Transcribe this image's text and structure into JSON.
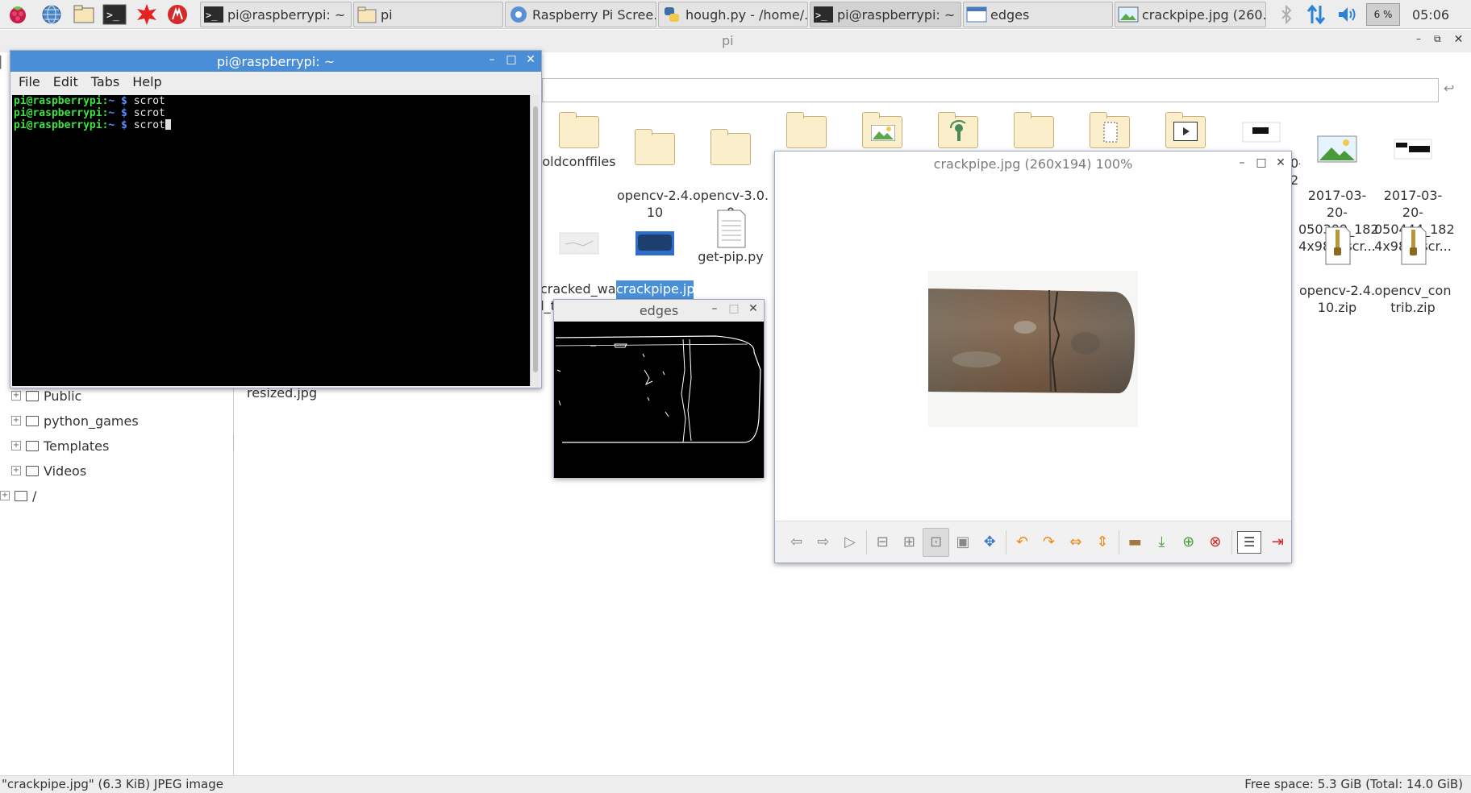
{
  "taskbar": {
    "launchers": [
      "raspberry-menu-icon",
      "web-browser-icon",
      "file-manager-icon",
      "terminal-icon",
      "math-kernel-icon",
      "wolfram-icon"
    ],
    "tasks": [
      {
        "label": "pi@raspberrypi: ~",
        "icon": "terminal-icon"
      },
      {
        "label": "pi",
        "icon": "folder-icon"
      },
      {
        "label": "Raspberry Pi Scree...",
        "icon": "chromium-icon"
      },
      {
        "label": "hough.py - /home/...",
        "icon": "python-icon"
      },
      {
        "label": "pi@raspberrypi: ~",
        "icon": "terminal-icon"
      },
      {
        "label": "edges",
        "icon": "window-icon"
      },
      {
        "label": "crackpipe.jpg (260...",
        "icon": "image-viewer-icon"
      }
    ],
    "cpu": "6 %",
    "clock": "05:06"
  },
  "file_manager": {
    "title": "pi",
    "status_left": "\"crackpipe.jpg\" (6.3 KiB) JPEG image",
    "status_right": "Free space: 5.3 GiB (Total: 14.0 GiB)",
    "tree": [
      {
        "label": "Public"
      },
      {
        "label": "python_games"
      },
      {
        "label": "Templates"
      },
      {
        "label": "Videos"
      },
      {
        "label": "/"
      }
    ],
    "files_row1": [
      {
        "name": "oldconffiles",
        "type": "folder"
      },
      {
        "name": "opencv-2.4.\n10",
        "type": "folder"
      },
      {
        "name": "opencv-3.0.\n0",
        "type": "folder"
      },
      {
        "name": "",
        "type": "folder"
      },
      {
        "name": "",
        "type": "image-folder"
      },
      {
        "name": "",
        "type": "broadcast-folder"
      },
      {
        "name": "",
        "type": "folder"
      },
      {
        "name": "",
        "type": "template-folder"
      },
      {
        "name": "",
        "type": "video-folder"
      },
      {
        "name": "",
        "type": "screenshot"
      },
      {
        "name": "2017-03-20-\n050309_182\n4x984_scr...",
        "type": "image"
      },
      {
        "name": "2017-03-20-\n050444_182\n4x984_scr...",
        "type": "image"
      }
    ],
    "files_row2": [
      {
        "name": "cracked_wal\nl_texture.pn\ng",
        "type": "image"
      },
      {
        "name": "crackpipe.jp\ng",
        "type": "image",
        "selected": true
      },
      {
        "name": "get-pip.py",
        "type": "text"
      },
      {
        "name": "opencv-2.4.\n10.zip",
        "type": "zip"
      },
      {
        "name": "opencv_con\ntrib.zip",
        "type": "zip"
      }
    ],
    "partial_labels": {
      "resized": "resized.jpg",
      "cut_2017": "0-\n2"
    }
  },
  "terminal": {
    "title": "pi@raspberrypi: ~",
    "menu": [
      "File",
      "Edit",
      "Tabs",
      "Help"
    ],
    "lines": [
      {
        "user": "pi@raspberrypi",
        "path": "~",
        "cmd": "scrot"
      },
      {
        "user": "pi@raspberrypi",
        "path": "~",
        "cmd": "scrot"
      },
      {
        "user": "pi@raspberrypi",
        "path": "~",
        "cmd": "scrot"
      }
    ]
  },
  "edges_window": {
    "title": "edges"
  },
  "viewer": {
    "title": "crackpipe.jpg (260x194) 100%",
    "toolbar": [
      "prev-icon",
      "next-icon",
      "slideshow-icon",
      "zoom-out-icon",
      "zoom-in-icon",
      "fit-icon",
      "original-size-icon",
      "fullscreen-icon",
      "rotate-left-icon",
      "rotate-right-icon",
      "flip-horizontal-icon",
      "flip-vertical-icon",
      "open-icon",
      "save-icon",
      "save-as-icon",
      "delete-icon",
      "preferences-icon",
      "quit-icon"
    ]
  },
  "colors": {
    "titlebar_active": "#4b8ed8",
    "selection": "#4a90d9",
    "prompt_green": "#3ee23e",
    "prompt_blue": "#5b8cff"
  }
}
